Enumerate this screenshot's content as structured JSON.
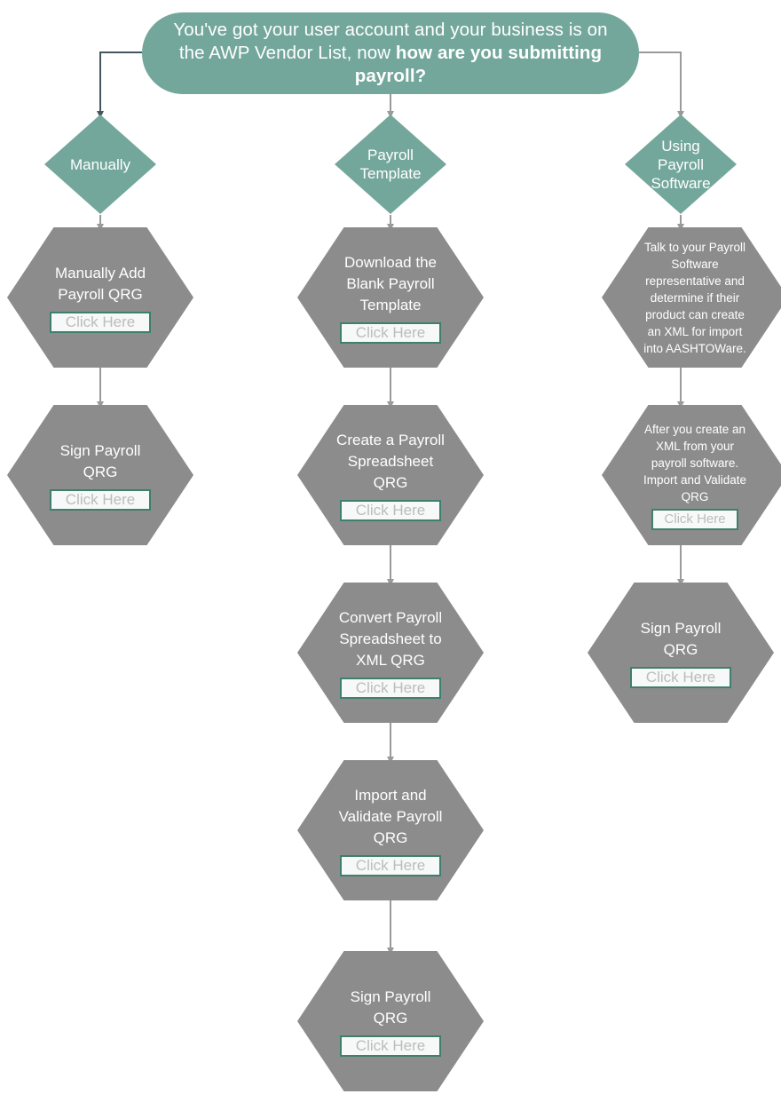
{
  "header": {
    "text_plain": "You've got your user account and your business is on the AWP Vendor List, now ",
    "text_bold": "how are you submitting payroll?",
    "fill": "#74a79b",
    "text_color": "#ffffff"
  },
  "colors": {
    "diamond_fill": "#74a79b",
    "hex_fill": "#8c8c8c",
    "hex_text": "#ffffff",
    "click_border": "#3f7f6d",
    "click_bg": "#f7f9f8",
    "click_text": "#b9bdbb",
    "connector_dark": "#47555e",
    "connector_gray": "#9a9a9a"
  },
  "click_label": "Click Here",
  "branches": [
    {
      "id": "manually",
      "decision": "Manually",
      "steps": [
        {
          "text": "Manually Add\nPayroll QRG",
          "has_click": true,
          "size": "normal"
        },
        {
          "text": "Sign Payroll\nQRG",
          "has_click": true,
          "size": "normal"
        }
      ]
    },
    {
      "id": "payroll-template",
      "decision": "Payroll\nTemplate",
      "steps": [
        {
          "text": "Download the\nBlank Payroll\nTemplate",
          "has_click": true,
          "size": "normal"
        },
        {
          "text": "Create a Payroll\nSpreadsheet\nQRG",
          "has_click": true,
          "size": "normal"
        },
        {
          "text": "Convert Payroll\nSpreadsheet to\nXML QRG",
          "has_click": true,
          "size": "normal"
        },
        {
          "text": "Import and\nValidate Payroll\nQRG",
          "has_click": true,
          "size": "normal"
        },
        {
          "text": "Sign Payroll\nQRG",
          "has_click": true,
          "size": "normal"
        }
      ]
    },
    {
      "id": "using-payroll-software",
      "decision": "Using\nPayroll\nSoftware",
      "steps": [
        {
          "text": "Talk to your Payroll\nSoftware\nrepresentative and\ndetermine if their\nproduct can create\nan XML for import\ninto AASHTOWare.",
          "has_click": false,
          "size": "small"
        },
        {
          "text": "After you create an\nXML from your\npayroll software.\nImport and Validate\nQRG",
          "has_click": true,
          "size": "small"
        },
        {
          "text": "Sign Payroll\nQRG",
          "has_click": true,
          "size": "normal"
        }
      ]
    }
  ]
}
